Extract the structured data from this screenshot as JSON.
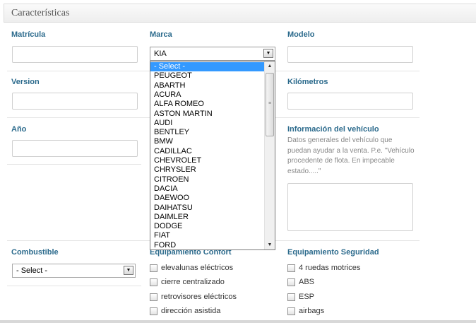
{
  "panel": {
    "title": "Características"
  },
  "labels": {
    "matricula": "Matrícula",
    "marca": "Marca",
    "modelo": "Modelo",
    "version": "Version",
    "kilometros": "Kilómetros",
    "anio": "Año",
    "info": "Información del vehículo",
    "combustible": "Combustible",
    "equipamiento_confort": "Equipamiento Confort",
    "equipamiento_seguridad": "Equipamiento Seguridad"
  },
  "marca_select": {
    "value": "KIA",
    "options": [
      "- Select -",
      "PEUGEOT",
      "ABARTH",
      "ACURA",
      "ALFA ROMEO",
      "ASTON MARTIN",
      "AUDI",
      "BENTLEY",
      "BMW",
      "CADILLAC",
      "CHEVROLET",
      "CHRYSLER",
      "CITROEN",
      "DACIA",
      "DAEWOO",
      "DAIHATSU",
      "DAIMLER",
      "DODGE",
      "FIAT",
      "FORD"
    ],
    "highlighted": "- Select -"
  },
  "combustible_select": {
    "value": "- Select -"
  },
  "info_help": "Datos generales del vehículo que puedan ayudar a la venta. P.e. \"Vehículo procedente de flota. En impecable estado.....\"",
  "confort": [
    "elevalunas eléctricos",
    "cierre centralizado",
    "retrovisores eléctricos",
    "dirección asistida"
  ],
  "seguridad": [
    "4 ruedas motrices",
    "ABS",
    "ESP",
    "airbags"
  ],
  "icons": {
    "dropdown_arrow": "chevron-down-icon",
    "scroll_up": "chevron-up-icon",
    "scroll_down": "chevron-down-icon"
  },
  "colors": {
    "label": "#2b6a8c",
    "highlight": "#3399ff"
  }
}
